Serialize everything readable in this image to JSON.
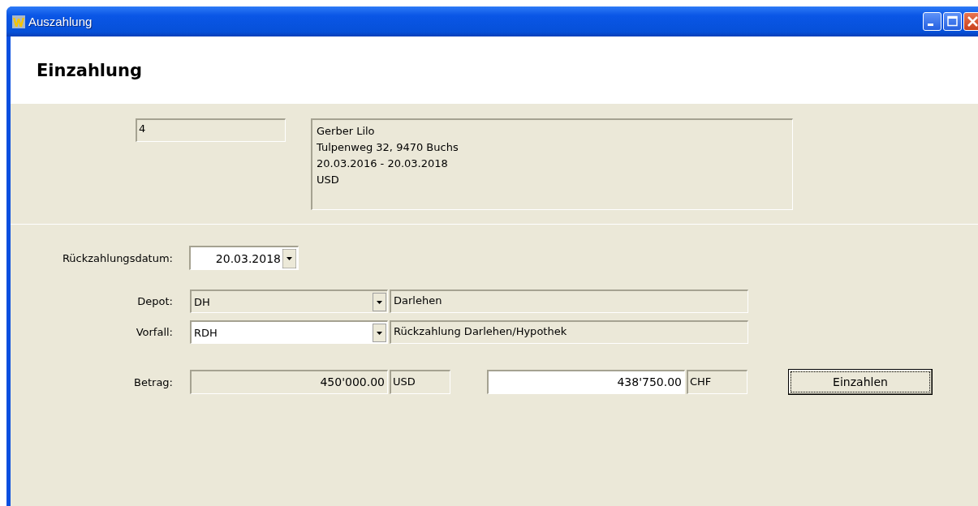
{
  "window": {
    "title": "Auszahlung"
  },
  "heading": "Einzahlung",
  "record": {
    "number": "4",
    "details": [
      "Gerber Lilo",
      "Tulpenweg 32, 9470 Buchs",
      "20.03.2016 - 20.03.2018",
      "USD"
    ]
  },
  "repayment_date": {
    "label": "Rückzahlungsdatum:",
    "value": "20.03.2018"
  },
  "lookups": [
    {
      "label": "Depot:",
      "code": "DH",
      "description": "Darlehen",
      "disabled": true
    },
    {
      "label": "Vorfall:",
      "code": "RDH",
      "description": "Rückzahlung Darlehen/Hypothek",
      "disabled": false
    }
  ],
  "amount": {
    "label": "Betrag:",
    "fields": [
      {
        "value": "450'000.00",
        "currency": "USD",
        "disabled": true
      },
      {
        "value": "438'750.00",
        "currency": "CHF",
        "disabled": false
      }
    ]
  },
  "buttons": [
    {
      "label": "Einzahlen"
    }
  ]
}
